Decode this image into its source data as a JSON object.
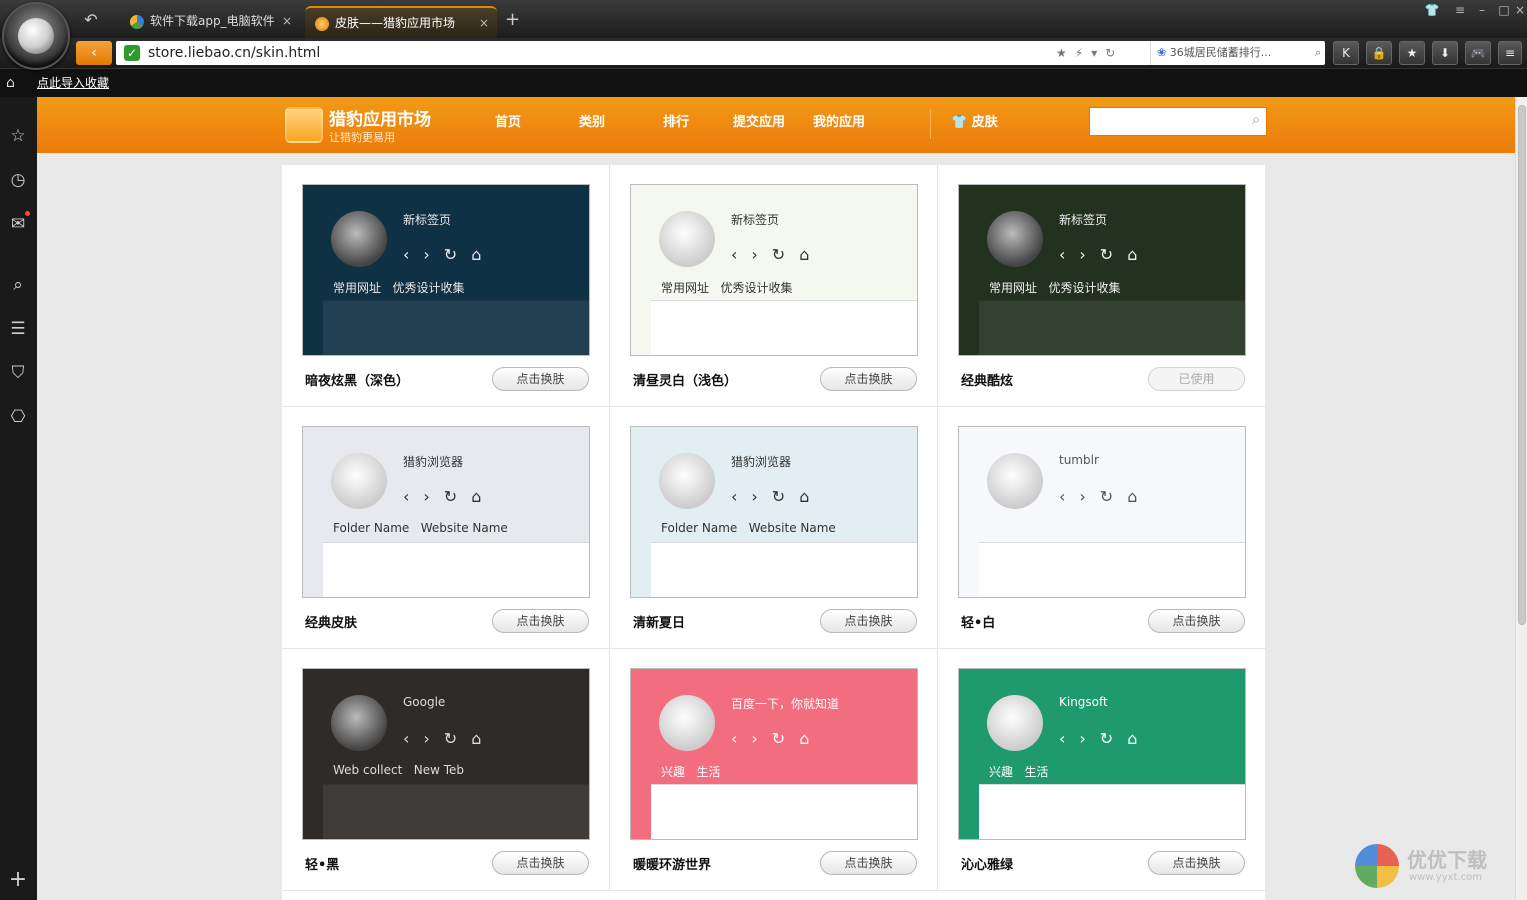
{
  "window": {
    "tabs": [
      {
        "label": "软件下载app_电脑软件",
        "close": "×"
      },
      {
        "label": "皮肤——猎豹应用市场",
        "close": "×"
      }
    ],
    "new_tab": "+"
  },
  "address_bar": {
    "url": "store.liebao.cn/skin.html",
    "search_text": "36城居民储蓄排行..."
  },
  "bookmark_bar": {
    "import_link": "点此导入收藏"
  },
  "header": {
    "brand_title": "猎豹应用市场",
    "brand_sub": "让猎豹更易用",
    "nav": [
      "首页",
      "类别",
      "排行",
      "提交应用",
      "我的应用"
    ],
    "skin_link": "皮肤",
    "search_value": ""
  },
  "skins": [
    {
      "name": "暗夜炫黑（深色）",
      "button": "点击换肤",
      "used": false,
      "tab": "新标签页",
      "bm1": "常用网址",
      "bm2": "优秀设计收集",
      "bg": "#0f3144",
      "fg": "#e8e8e8"
    },
    {
      "name": "清昼灵白（浅色）",
      "button": "点击换肤",
      "used": false,
      "tab": "新标签页",
      "bm1": "常用网址",
      "bm2": "优秀设计收集",
      "bg": "#f4f8f0",
      "fg": "#333333"
    },
    {
      "name": "经典酷炫",
      "button": "已使用",
      "used": true,
      "tab": "新标签页",
      "bm1": "常用网址",
      "bm2": "优秀设计收集",
      "bg": "#22321f",
      "fg": "#f0f0f0"
    },
    {
      "name": "经典皮肤",
      "button": "点击换肤",
      "used": false,
      "tab": "猎豹浏览器",
      "bm1": "Folder Name",
      "bm2": "Website Name",
      "bg": "#e7e9ee",
      "fg": "#333333"
    },
    {
      "name": "清新夏日",
      "button": "点击换肤",
      "used": false,
      "tab": "猎豹浏览器",
      "bm1": "Folder Name",
      "bm2": "Website Name",
      "bg": "#e3eef2",
      "fg": "#333333"
    },
    {
      "name": "轻•白",
      "button": "点击换肤",
      "used": false,
      "tab": "tumblr",
      "bm1": "",
      "bm2": "",
      "bg": "#f6f8fb",
      "fg": "#555555"
    },
    {
      "name": "轻•黑",
      "button": "点击换肤",
      "used": false,
      "tab": "Google",
      "bm1": "Web collect",
      "bm2": "New Teb",
      "bg": "#2f2b28",
      "fg": "#dddddd"
    },
    {
      "name": "暖暖环游世界",
      "button": "点击换肤",
      "used": false,
      "tab": "百度一下，你就知道",
      "bm1": "兴趣",
      "bm2": "生活",
      "bg": "#f26d7d",
      "fg": "#ffffff"
    },
    {
      "name": "沁心雅绿",
      "button": "点击换肤",
      "used": false,
      "tab": "Kingsoft",
      "bm1": "兴趣",
      "bm2": "生活",
      "bg": "#1f9a6f",
      "fg": "#ffffff"
    }
  ],
  "watermark": {
    "title": "优优下载",
    "url": "www.yyxt.com"
  }
}
